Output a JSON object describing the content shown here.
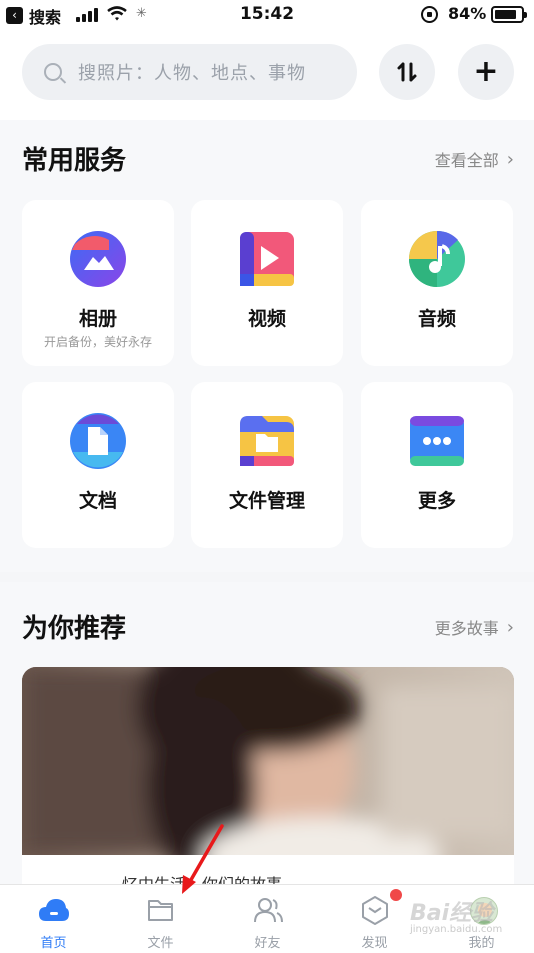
{
  "status_bar": {
    "back_app": "搜索",
    "time": "15:42",
    "battery": "84%",
    "battery_level": 0.84
  },
  "search": {
    "placeholder": "搜照片：人物、地点、事物"
  },
  "services": {
    "title": "常用服务",
    "more": "查看全部",
    "items": [
      {
        "label": "相册",
        "sub": "开启备份，美好永存",
        "icon": "album-icon"
      },
      {
        "label": "视频",
        "sub": "",
        "icon": "video-icon"
      },
      {
        "label": "音频",
        "sub": "",
        "icon": "audio-icon"
      },
      {
        "label": "文档",
        "sub": "",
        "icon": "document-icon"
      },
      {
        "label": "文件管理",
        "sub": "",
        "icon": "folder-icon"
      },
      {
        "label": "更多",
        "sub": "",
        "icon": "more-icon"
      }
    ]
  },
  "recommend": {
    "title": "为你推荐",
    "more": "更多故事",
    "caption": "…忆中生活…你们的故事"
  },
  "tabbar": {
    "tabs": [
      {
        "label": "首页",
        "icon": "cloud-home-icon",
        "active": true
      },
      {
        "label": "文件",
        "icon": "folder-tab-icon",
        "active": false
      },
      {
        "label": "好友",
        "icon": "friends-icon",
        "active": false
      },
      {
        "label": "发现",
        "icon": "discover-icon",
        "active": false
      },
      {
        "label": "我的",
        "icon": "profile-avatar",
        "active": false
      }
    ]
  },
  "watermark": {
    "brand": "Bai经验",
    "url": "jingyan.baidu.com"
  },
  "colors": {
    "accent": "#2f7cf6",
    "badge": "#f04848",
    "annotation_arrow": "#e8191b"
  }
}
